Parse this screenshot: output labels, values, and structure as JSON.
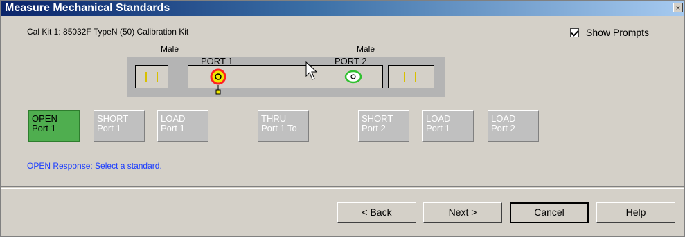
{
  "window": {
    "title": "Measure Mechanical Standards",
    "close_glyph": "×",
    "kit_label": "Cal Kit 1:  85032F TypeN (50) Calibration Kit"
  },
  "show_prompts": {
    "label": "Show Prompts",
    "checked": true
  },
  "diagram": {
    "left_connector_gender": "Male",
    "right_connector_gender": "Male",
    "port1_label": "PORT 1",
    "port2_label": "PORT 2"
  },
  "standards": [
    {
      "line1": "OPEN",
      "line2": "Port 1",
      "active": true
    },
    {
      "line1": "SHORT",
      "line2": "Port 1",
      "active": false
    },
    {
      "line1": "LOAD",
      "line2": "Port 1",
      "active": false
    },
    {
      "line1": "THRU",
      "line2": "Port 1 To",
      "active": false
    },
    {
      "line1": "SHORT",
      "line2": "Port 2",
      "active": false
    },
    {
      "line1": "LOAD",
      "line2": "Port 1",
      "active": false
    },
    {
      "line1": "LOAD",
      "line2": "Port 2",
      "active": false
    }
  ],
  "status_text": "OPEN Response: Select a standard.",
  "buttons": {
    "back": "< Back",
    "next": "Next >",
    "cancel": "Cancel",
    "help": "Help"
  },
  "colors": {
    "active_standard": "#4fae4f",
    "status_text": "#1a3cff",
    "port1_ring": "#ff2020",
    "port2_ring": "#30c030"
  }
}
